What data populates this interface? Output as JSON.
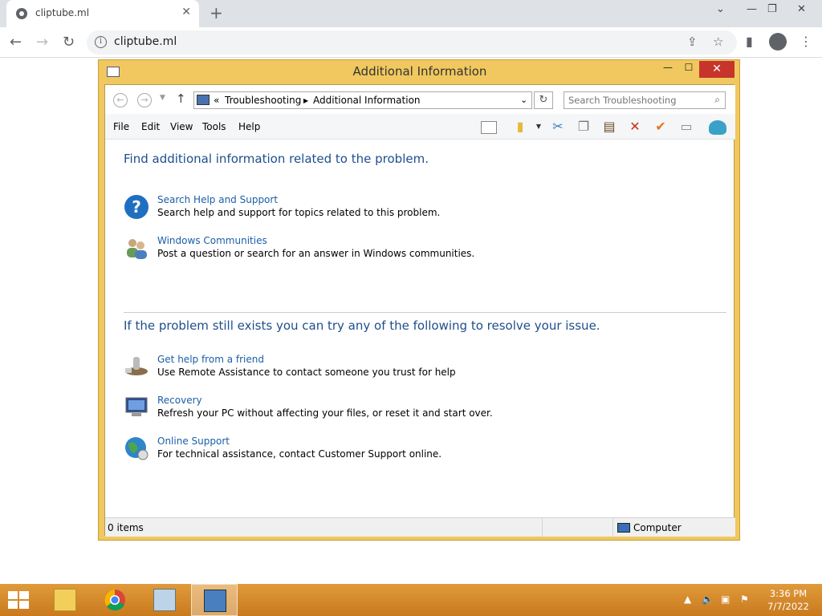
{
  "browser": {
    "tab_title": "cliptube.ml",
    "tab_close": "✕",
    "new_tab": "+",
    "url": "cliptube.ml",
    "window_controls": [
      "⌄",
      "—",
      "❐",
      "✕"
    ]
  },
  "window": {
    "title": "Additional Information",
    "controls": {
      "minimize": "—",
      "maximize": "☐",
      "close": "✕"
    },
    "breadcrumb": {
      "prefix": "«",
      "items": [
        "Troubleshooting",
        "Additional Information"
      ]
    },
    "search_placeholder": "Search Troubleshooting",
    "menu": [
      "File",
      "Edit",
      "View",
      "Tools",
      "Help"
    ],
    "toolbar_icons": [
      "layout-icon",
      "folder-icon",
      "cut-icon",
      "copy-icon",
      "paste-icon",
      "delete-icon",
      "check-icon",
      "properties-icon",
      "shell-icon"
    ]
  },
  "content": {
    "heading1": "Find additional information related to the problem.",
    "section1": [
      {
        "link": "Search Help and Support",
        "desc": "Search help and support for topics related to this problem.",
        "icon": "help-icon"
      },
      {
        "link": "Windows Communities",
        "desc": "Post a question or search for an answer in Windows communities.",
        "icon": "users-icon"
      }
    ],
    "heading2": "If the problem still exists you can try any of the following to resolve your issue.",
    "section2": [
      {
        "link": "Get help from a friend",
        "desc": "Use Remote Assistance to contact someone you trust for help",
        "icon": "remote-assistance-icon"
      },
      {
        "link": "Recovery",
        "desc": "Refresh your PC without affecting your files, or reset it and start over.",
        "icon": "recovery-icon"
      },
      {
        "link": "Online Support",
        "desc": "For technical assistance, contact Customer Support online.",
        "icon": "globe-icon"
      }
    ]
  },
  "status": {
    "items": "0 items",
    "location": "Computer"
  },
  "taskbar": {
    "time": "3:36 PM",
    "date": "7/7/2022"
  },
  "colors": {
    "window_frame": "#f0c85f",
    "link": "#1a5ea8",
    "heading": "#1e4e8c",
    "taskbar": "#d68a2a",
    "close": "#c7342c"
  }
}
